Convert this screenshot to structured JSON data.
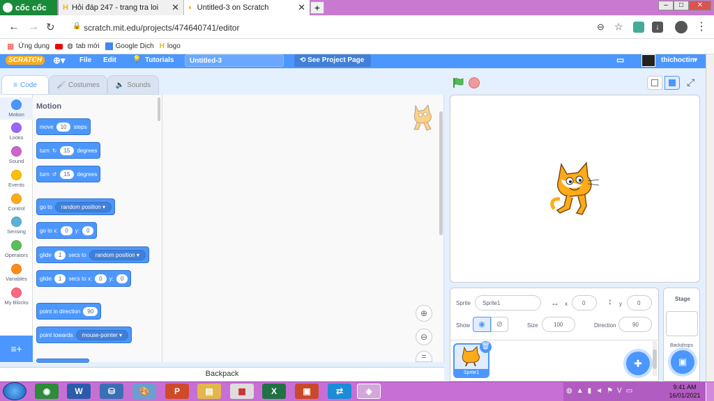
{
  "browser": {
    "brand": "cốc cốc",
    "tabs": [
      {
        "label": "Hỏi đáp 247 - trang tra loi",
        "active": false
      },
      {
        "label": "Untitled-3 on Scratch",
        "active": true
      }
    ],
    "new_tab": "+",
    "url": "scratch.mit.edu/projects/474640741/editor",
    "bookmarks": [
      "Ứng dụng",
      "tab mới",
      "Google Dịch",
      "logo"
    ]
  },
  "menubar": {
    "logo": "SCRATCH",
    "file": "File",
    "edit": "Edit",
    "tutorials": "Tutorials",
    "project_title": "Untitled-3",
    "see_project": "See Project Page",
    "user": "thichoctin"
  },
  "editor_tabs": [
    "Code",
    "Costumes",
    "Sounds"
  ],
  "categories": [
    {
      "label": "Motion",
      "color": "#4c97ff"
    },
    {
      "label": "Looks",
      "color": "#9966ff"
    },
    {
      "label": "Sound",
      "color": "#cf63cf"
    },
    {
      "label": "Events",
      "color": "#ffbf00"
    },
    {
      "label": "Control",
      "color": "#ffab19"
    },
    {
      "label": "Sensing",
      "color": "#5cb1d6"
    },
    {
      "label": "Operators",
      "color": "#59c059"
    },
    {
      "label": "Variables",
      "color": "#ff8c1a"
    },
    {
      "label": "My Blocks",
      "color": "#ff6680"
    }
  ],
  "palette": {
    "heading": "Motion",
    "blocks": {
      "move": {
        "a": "move",
        "v": "10",
        "b": "steps"
      },
      "turn_right": {
        "a": "turn",
        "v": "15",
        "b": "degrees"
      },
      "turn_left": {
        "a": "turn",
        "v": "15",
        "b": "degrees"
      },
      "goto": {
        "a": "go to",
        "d": "random position"
      },
      "goto_xy": {
        "a": "go to x:",
        "x": "0",
        "yl": "y:",
        "y": "0"
      },
      "glide": {
        "a": "glide",
        "v": "1",
        "b": "secs to",
        "d": "random position"
      },
      "glide_xy": {
        "a": "glide",
        "v": "1",
        "b": "secs to x:",
        "x": "0",
        "yl": "y:",
        "y": "0"
      },
      "point_dir": {
        "a": "point in direction",
        "v": "90"
      },
      "point_towards": {
        "a": "point towards",
        "d": "mouse-pointer"
      }
    }
  },
  "backpack": "Backpack",
  "sprite_info": {
    "sprite_label": "Sprite",
    "sprite_name": "Sprite1",
    "x_label": "x",
    "x": "0",
    "y_label": "y",
    "y": "0",
    "show_label": "Show",
    "size_label": "Size",
    "size": "100",
    "direction_label": "Direction",
    "direction": "90",
    "thumb_name": "Sprite1"
  },
  "stage_pane": {
    "label": "Stage",
    "backdrops": "Backdrops"
  },
  "taskbar": {
    "time": "9:41 AM",
    "date": "16/01/2021"
  },
  "colors": {
    "scratch_blue": "#4c97ff",
    "taskbar": "#c86fd6"
  }
}
